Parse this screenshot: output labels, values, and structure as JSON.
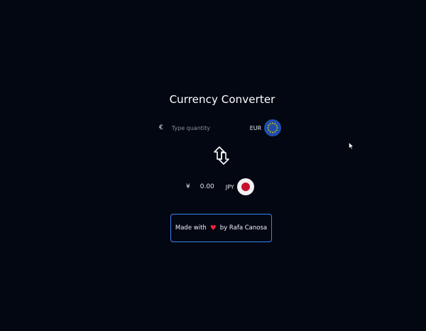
{
  "title": "Currency Converter",
  "from": {
    "symbol": "€",
    "placeholder": "Type quantity",
    "value": "",
    "code": "EUR",
    "flag_icon": "eu-flag-icon"
  },
  "to": {
    "symbol": "¥",
    "result": "0.00",
    "code": "JPY",
    "flag_icon": "japan-flag-icon"
  },
  "swap_icon": "swap-arrows-icon",
  "credit": {
    "prefix": "Made with",
    "heart": "♥",
    "suffix": "by Rafa Canosa",
    "border_color": "#3b82f6"
  },
  "colors": {
    "background": "#030712",
    "eu_blue": "#1e4ea8",
    "jp_red": "#c8102e"
  }
}
